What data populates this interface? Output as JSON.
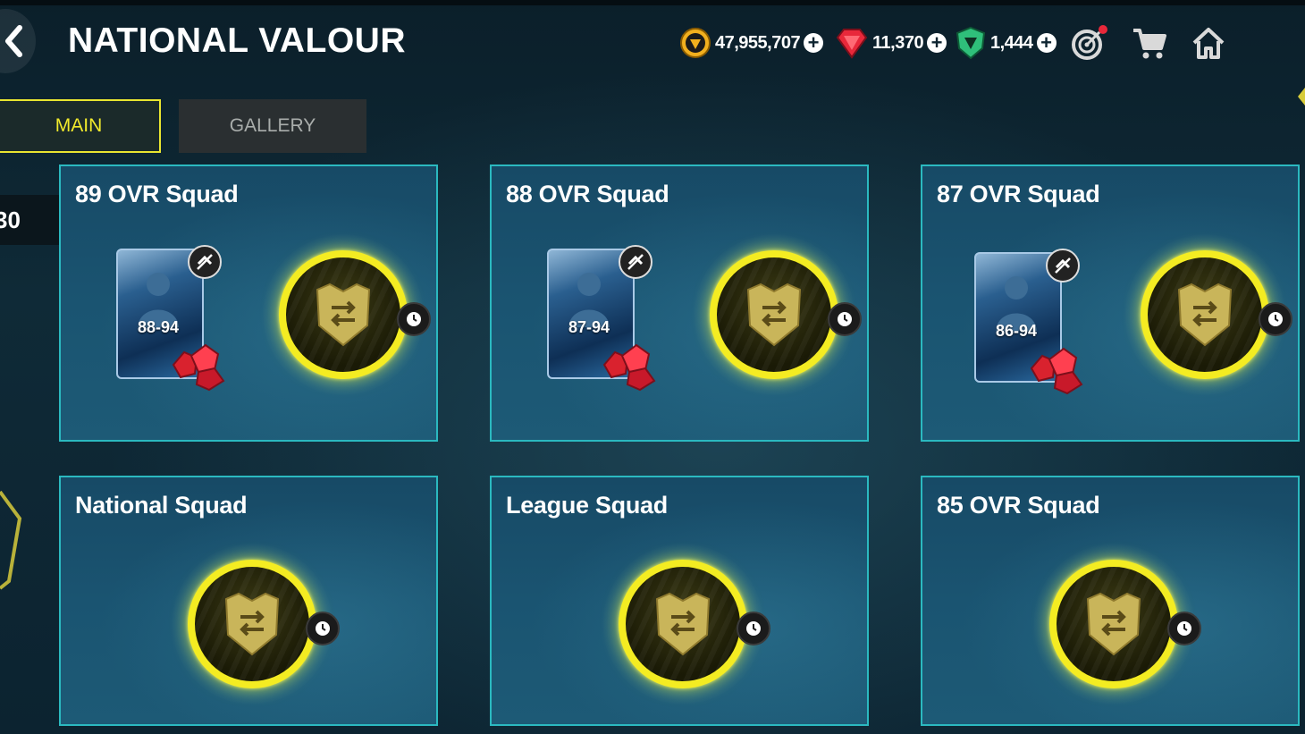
{
  "header": {
    "title": "NATIONAL VALOUR"
  },
  "currencies": [
    {
      "name": "coins",
      "amount": "47,955,707",
      "color": "#f2b01e"
    },
    {
      "name": "gems",
      "amount": "11,370",
      "color": "#e8283a"
    },
    {
      "name": "points",
      "amount": "1,444",
      "color": "#2fbf7a"
    }
  ],
  "tabs": {
    "main": "MAIN",
    "gallery": "GALLERY"
  },
  "side_badge": "30",
  "cards": [
    {
      "title": "89 OVR Squad",
      "has_player": true,
      "rating": "88-94"
    },
    {
      "title": "88 OVR Squad",
      "has_player": true,
      "rating": "87-94"
    },
    {
      "title": "87 OVR Squad",
      "has_player": true,
      "rating": "86-94"
    },
    {
      "title": "National Squad",
      "has_player": false
    },
    {
      "title": "League Squad",
      "has_player": false
    },
    {
      "title": "85 OVR Squad",
      "has_player": false
    }
  ],
  "colors": {
    "accent_yellow": "#f4ec22",
    "card_border": "#2bb9c0"
  }
}
